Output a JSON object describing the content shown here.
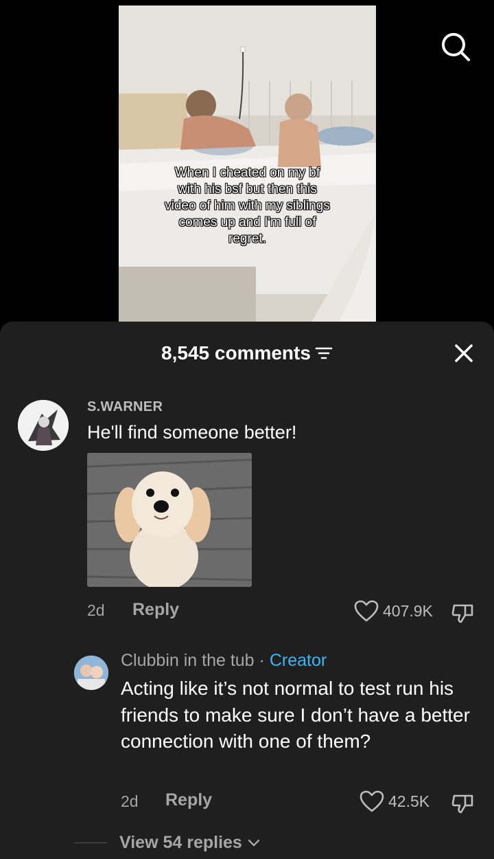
{
  "video": {
    "caption": "When I cheated on my bf\nwith his bsf but then this\nvideo of him with my siblings\ncomes up and I'm full of\nregret."
  },
  "icons": {
    "search": "search-icon",
    "filter": "filter-icon",
    "close": "close-icon",
    "heart": "heart-icon",
    "dislike": "thumbs-down-icon",
    "chevron": "chevron-down-icon"
  },
  "colors": {
    "sheet_bg": "#1f1f1f",
    "creator_accent": "#3ab7f7",
    "muted_text": "#a6a6a6"
  },
  "comments_sheet": {
    "title": "8,545 comments"
  },
  "comments": [
    {
      "username": "S.WARNER",
      "text": "He'll find someone better!",
      "time": "2d",
      "reply_label": "Reply",
      "likes": "407.9K"
    },
    {
      "username": "Clubbin in the tub",
      "separator": " · ",
      "badge": "Creator",
      "text": "Acting like it’s not normal to test run his friends to make sure I don’t have a better connection with one of them?",
      "time": "2d",
      "reply_label": "Reply",
      "likes": "42.5K",
      "view_replies": "View 54 replies"
    }
  ]
}
